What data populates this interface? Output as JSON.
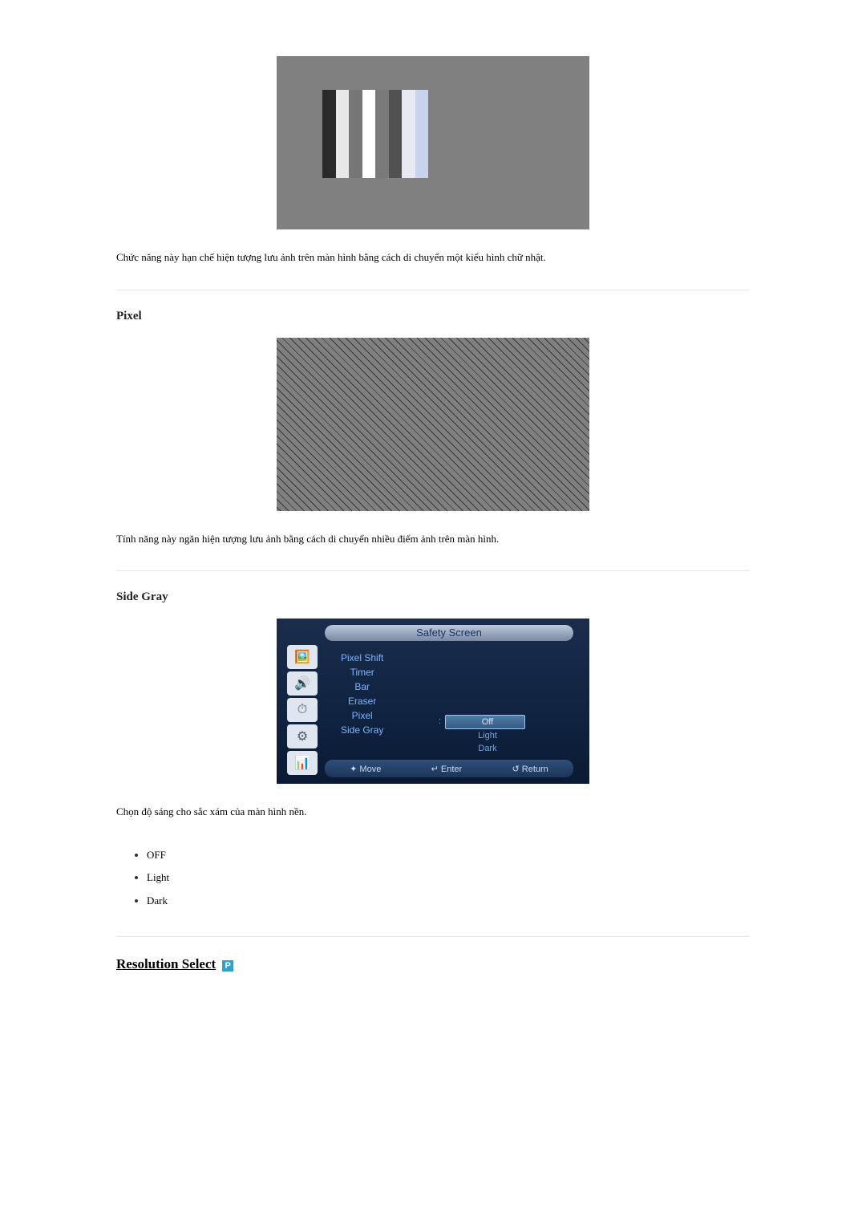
{
  "section1": {
    "caption": "Chức năng này hạn chế hiện tượng lưu ảnh trên màn hình bằng cách di chuyển một kiểu hình chữ nhật."
  },
  "section2": {
    "heading": "Pixel",
    "caption": "Tính năng này ngăn hiện tượng lưu ảnh bằng cách di chuyển nhiều điểm ảnh trên màn hình."
  },
  "section3": {
    "heading": "Side Gray",
    "caption": "Chọn độ sáng cho sắc xám của màn hình nền.",
    "bullets": [
      "OFF",
      "Light",
      "Dark"
    ]
  },
  "osd": {
    "title": "Safety Screen",
    "menu": [
      "Pixel Shift",
      "Timer",
      "Bar",
      "Eraser",
      "Pixel",
      "Side Gray"
    ],
    "options": [
      "Off",
      "Light",
      "Dark"
    ],
    "footer": {
      "move": "Move",
      "enter": "Enter",
      "return": "Return"
    }
  },
  "resolution": {
    "label": "Resolution Select",
    "badge": "P"
  }
}
